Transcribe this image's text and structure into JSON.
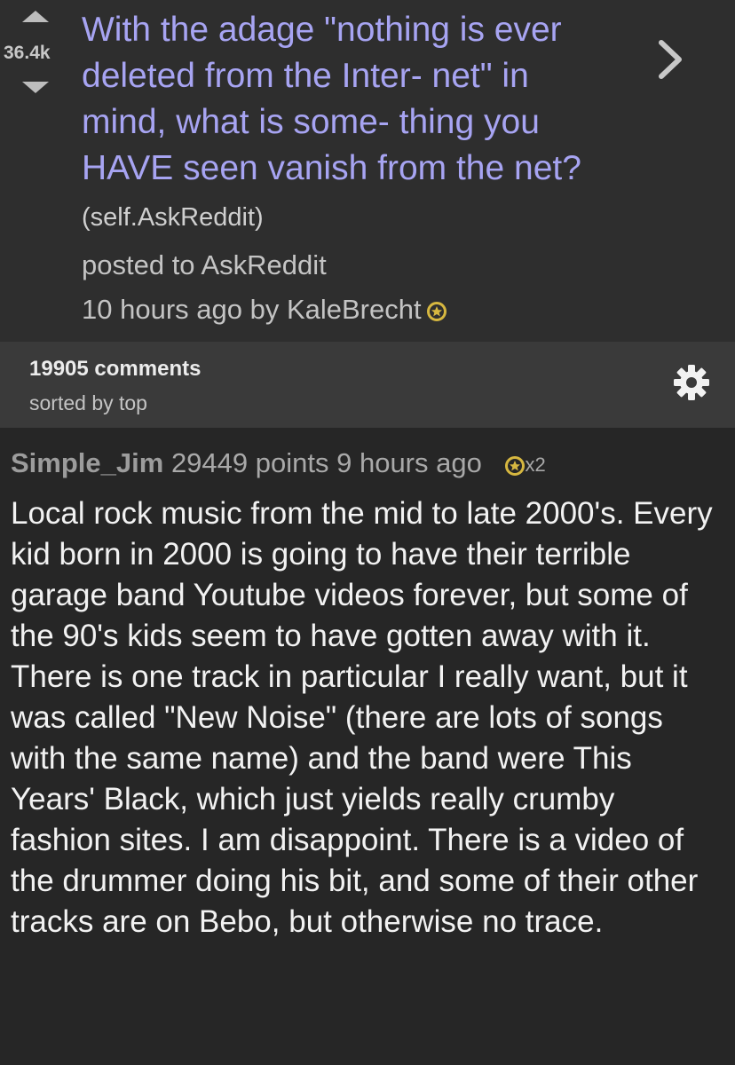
{
  "post": {
    "score": "36.4k",
    "title": "With the adage \"nothing is ever deleted from the Inter- net\" in mind, what is some- thing you HAVE seen vanish from the net?",
    "domain": "(self.AskReddit)",
    "posted_to": "posted to AskReddit",
    "time_by": "10 hours ago by KaleBrecht"
  },
  "comments_bar": {
    "count": "19905 comments",
    "sort": "sorted by top"
  },
  "comment": {
    "author": "Simple_Jim",
    "points": "29449 points",
    "time": "9 hours ago",
    "award_count": "x2",
    "body": "Local rock music from the mid to late 2000's. Every kid born in 2000 is going to have their terrible garage band Youtube videos forever, but some of the 90's kids seem to have gotten away with it. There is one track in particular I really want, but it was called \"New Noise\" (there are lots of songs with the same name) and the band were This Years' Black, which just yields really crumby fashion sites. I am disappoint. There is a video of the drummer doing his bit, and some of their other tracks are on Bebo, but otherwise no trace."
  },
  "icons": {
    "upvote": "upvote-arrow-icon",
    "downvote": "downvote-arrow-icon",
    "open": "chevron-right-icon",
    "gold": "gold-award-icon",
    "settings": "gear-icon"
  },
  "colors": {
    "title": "#a7a4f2",
    "header_bg": "#2e2e2e",
    "bar_bg": "#3a3a3a",
    "page_bg": "#262626",
    "gold": "#d6b740"
  }
}
